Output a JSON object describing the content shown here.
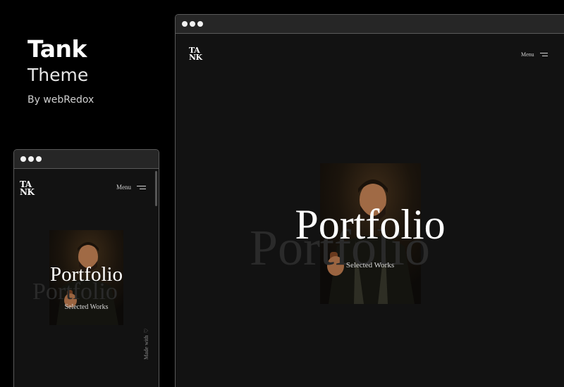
{
  "brand": {
    "title": "Tank",
    "subtitle": "Theme",
    "byline": "By webRedox"
  },
  "site": {
    "logo_line1": "TA",
    "logo_line2": "NK",
    "menu_label": "Menu",
    "hero_title": "Portfolio",
    "hero_ghost": "Portfolio",
    "hero_subtitle": "Selected Works",
    "made_with": "Made with"
  },
  "colors": {
    "background": "#000000",
    "window_bar": "#262626",
    "page_bg": "#121212",
    "ghost_text": "#2a2a2a"
  },
  "icons": [
    "window-dot-icon",
    "hamburger-menu-icon",
    "heart-icon"
  ]
}
